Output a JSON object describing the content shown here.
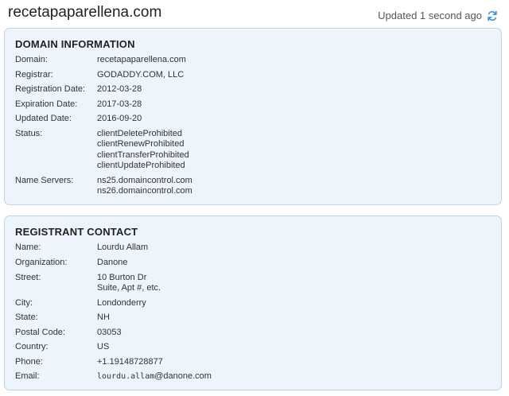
{
  "header": {
    "domain": "recetapaparellena.com",
    "updated_text": "Updated 1 second ago",
    "refresh_icon": "refresh-icon"
  },
  "domain_info": {
    "title": "DOMAIN INFORMATION",
    "domain_label": "Domain:",
    "domain_value": "recetapaparellena.com",
    "registrar_label": "Registrar:",
    "registrar_value": "GODADDY.COM, LLC",
    "registration_date_label": "Registration Date:",
    "registration_date_value": "2012-03-28",
    "expiration_date_label": "Expiration Date:",
    "expiration_date_value": "2017-03-28",
    "updated_date_label": "Updated Date:",
    "updated_date_value": "2016-09-20",
    "status_label": "Status:",
    "status_values": [
      "clientDeleteProhibited",
      "clientRenewProhibited",
      "clientTransferProhibited",
      "clientUpdateProhibited"
    ],
    "name_servers_label": "Name Servers:",
    "name_servers_values": [
      "ns25.domaincontrol.com",
      "ns26.domaincontrol.com"
    ]
  },
  "registrant": {
    "title": "REGISTRANT CONTACT",
    "name_label": "Name:",
    "name_value": "Lourdu Allam",
    "organization_label": "Organization:",
    "organization_value": "Danone",
    "street_label": "Street:",
    "street_values": [
      "10 Burton Dr",
      "Suite, Apt #, etc."
    ],
    "city_label": "City:",
    "city_value": "Londonderry",
    "state_label": "State:",
    "state_value": "NH",
    "postal_code_label": "Postal Code:",
    "postal_code_value": "03053",
    "country_label": "Country:",
    "country_value": "US",
    "phone_label": "Phone:",
    "phone_value": "+1.19148728877",
    "email_label": "Email:",
    "email_user": "lourdu.allam",
    "email_domain": "@danone.com"
  },
  "colors": {
    "card_background": "#edf4fb",
    "card_border": "#bcd3ea",
    "refresh_icon": "#3b8fd9"
  }
}
